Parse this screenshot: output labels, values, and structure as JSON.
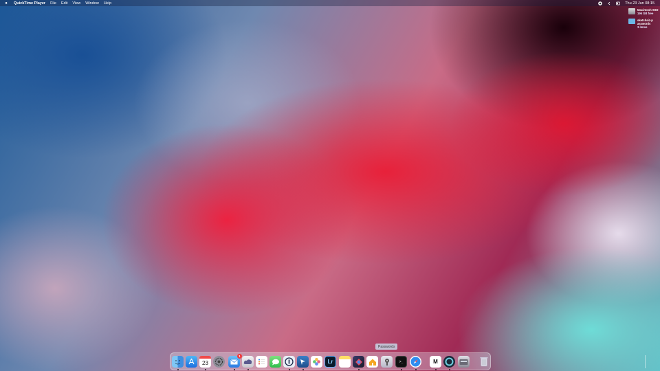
{
  "menubar": {
    "apple_icon": "apple-logo-icon",
    "app_name": "QuickTime Player",
    "menus": [
      "File",
      "Edit",
      "View",
      "Window",
      "Help"
    ],
    "clock": "Thu 23 Jun  08:15"
  },
  "desktop": {
    "disk": {
      "name": "Macintosh SSD",
      "info": "196 GB free"
    },
    "folder": {
      "name": "sketchsiz-passwords",
      "info": "3 items"
    }
  },
  "dock": {
    "tooltip": "Passwords",
    "calendar_day": "23",
    "mail_badge": "1",
    "lightroom_label": "Lr",
    "things_label": "✓",
    "terminal_label": ">_",
    "gmail_label": "M",
    "apps": [
      "finder",
      "app-store",
      "calendar",
      "settings",
      "mail",
      "cloud",
      "reminders",
      "messages",
      "1password",
      "pinned",
      "photos",
      "lightroom",
      "notes",
      "dropzone",
      "home",
      "passwords",
      "terminal",
      "safari",
      "gmail",
      "qreate",
      "disk-utility",
      "trash"
    ]
  },
  "colors": {
    "badge": "#f03a3a",
    "menubar_text": "#ffffff"
  }
}
